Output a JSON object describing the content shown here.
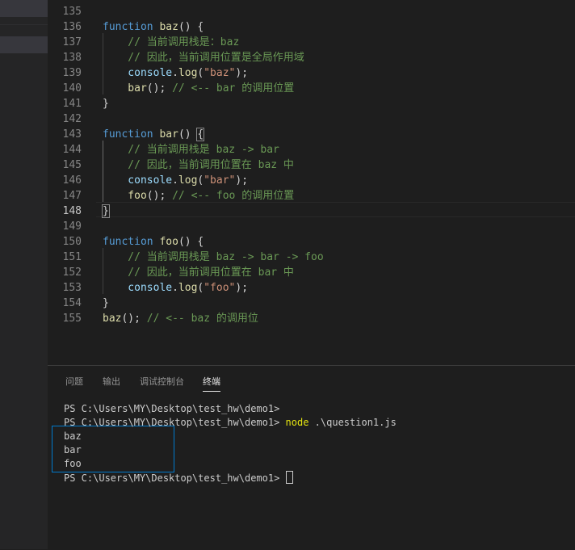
{
  "editor": {
    "lines": [
      {
        "no": "135",
        "segs": []
      },
      {
        "no": "136",
        "segs": [
          {
            "c": "kw",
            "t": "function "
          },
          {
            "c": "fn",
            "t": "baz"
          },
          {
            "c": "pl",
            "t": "() {"
          }
        ]
      },
      {
        "no": "137",
        "segs": [
          {
            "c": "cm",
            "t": "    // 当前调用栈是：baz"
          }
        ]
      },
      {
        "no": "138",
        "segs": [
          {
            "c": "cm",
            "t": "    // 因此，当前调用位置是全局作用域"
          }
        ]
      },
      {
        "no": "139",
        "segs": [
          {
            "c": "vr",
            "t": "    console"
          },
          {
            "c": "pl",
            "t": "."
          },
          {
            "c": "fn",
            "t": "log"
          },
          {
            "c": "pl",
            "t": "("
          },
          {
            "c": "st",
            "t": "\"baz\""
          },
          {
            "c": "pl",
            "t": ");"
          }
        ]
      },
      {
        "no": "140",
        "segs": [
          {
            "c": "fn",
            "t": "    bar"
          },
          {
            "c": "pl",
            "t": "(); "
          },
          {
            "c": "cm",
            "t": "// <-- bar 的调用位置"
          }
        ]
      },
      {
        "no": "141",
        "segs": [
          {
            "c": "pl",
            "t": "}"
          }
        ]
      },
      {
        "no": "142",
        "segs": []
      },
      {
        "no": "143",
        "segs": [
          {
            "c": "kw",
            "t": "function "
          },
          {
            "c": "fn",
            "t": "bar"
          },
          {
            "c": "pl",
            "t": "() "
          },
          {
            "c": "brk",
            "t": "{"
          }
        ]
      },
      {
        "no": "144",
        "segs": [
          {
            "c": "cm",
            "t": "    // 当前调用栈是 baz -> bar"
          }
        ]
      },
      {
        "no": "145",
        "segs": [
          {
            "c": "cm",
            "t": "    // 因此，当前调用位置在 baz 中"
          }
        ]
      },
      {
        "no": "146",
        "segs": [
          {
            "c": "vr",
            "t": "    console"
          },
          {
            "c": "pl",
            "t": "."
          },
          {
            "c": "fn",
            "t": "log"
          },
          {
            "c": "pl",
            "t": "("
          },
          {
            "c": "st",
            "t": "\"bar\""
          },
          {
            "c": "pl",
            "t": ");"
          }
        ]
      },
      {
        "no": "147",
        "segs": [
          {
            "c": "fn",
            "t": "    foo"
          },
          {
            "c": "pl",
            "t": "(); "
          },
          {
            "c": "cm",
            "t": "// <-- foo 的调用位置"
          }
        ]
      },
      {
        "no": "148",
        "segs": [
          {
            "c": "brk",
            "t": "}"
          }
        ],
        "active": true
      },
      {
        "no": "149",
        "segs": []
      },
      {
        "no": "150",
        "segs": [
          {
            "c": "kw",
            "t": "function "
          },
          {
            "c": "fn",
            "t": "foo"
          },
          {
            "c": "pl",
            "t": "() {"
          }
        ]
      },
      {
        "no": "151",
        "segs": [
          {
            "c": "cm",
            "t": "    // 当前调用栈是 baz -> bar -> foo"
          }
        ]
      },
      {
        "no": "152",
        "segs": [
          {
            "c": "cm",
            "t": "    // 因此，当前调用位置在 bar 中"
          }
        ]
      },
      {
        "no": "153",
        "segs": [
          {
            "c": "vr",
            "t": "    console"
          },
          {
            "c": "pl",
            "t": "."
          },
          {
            "c": "fn",
            "t": "log"
          },
          {
            "c": "pl",
            "t": "("
          },
          {
            "c": "st",
            "t": "\"foo\""
          },
          {
            "c": "pl",
            "t": ");"
          }
        ]
      },
      {
        "no": "154",
        "segs": [
          {
            "c": "pl",
            "t": "}"
          }
        ]
      },
      {
        "no": "155",
        "segs": [
          {
            "c": "fn",
            "t": "baz"
          },
          {
            "c": "pl",
            "t": "(); "
          },
          {
            "c": "cm",
            "t": "// <-- baz 的调用位"
          }
        ]
      }
    ]
  },
  "panel": {
    "tabs": [
      {
        "label": "问题",
        "active": false
      },
      {
        "label": "输出",
        "active": false
      },
      {
        "label": "调试控制台",
        "active": false
      },
      {
        "label": "终端",
        "active": true
      }
    ],
    "terminal": {
      "prompt1": "PS C:\\Users\\MY\\Desktop\\test_hw\\demo1>",
      "prompt2": "PS C:\\Users\\MY\\Desktop\\test_hw\\demo1> ",
      "command": "node",
      "args": " .\\question1.js",
      "out1": "baz",
      "out2": "bar",
      "out3": "foo",
      "prompt3": "PS C:\\Users\\MY\\Desktop\\test_hw\\demo1> "
    }
  },
  "colors": {
    "keyword": "#569cd6",
    "function": "#dcdcaa",
    "comment": "#6a9955",
    "string": "#ce9178",
    "variable": "#9cdcfe",
    "accent": "#007acc"
  }
}
